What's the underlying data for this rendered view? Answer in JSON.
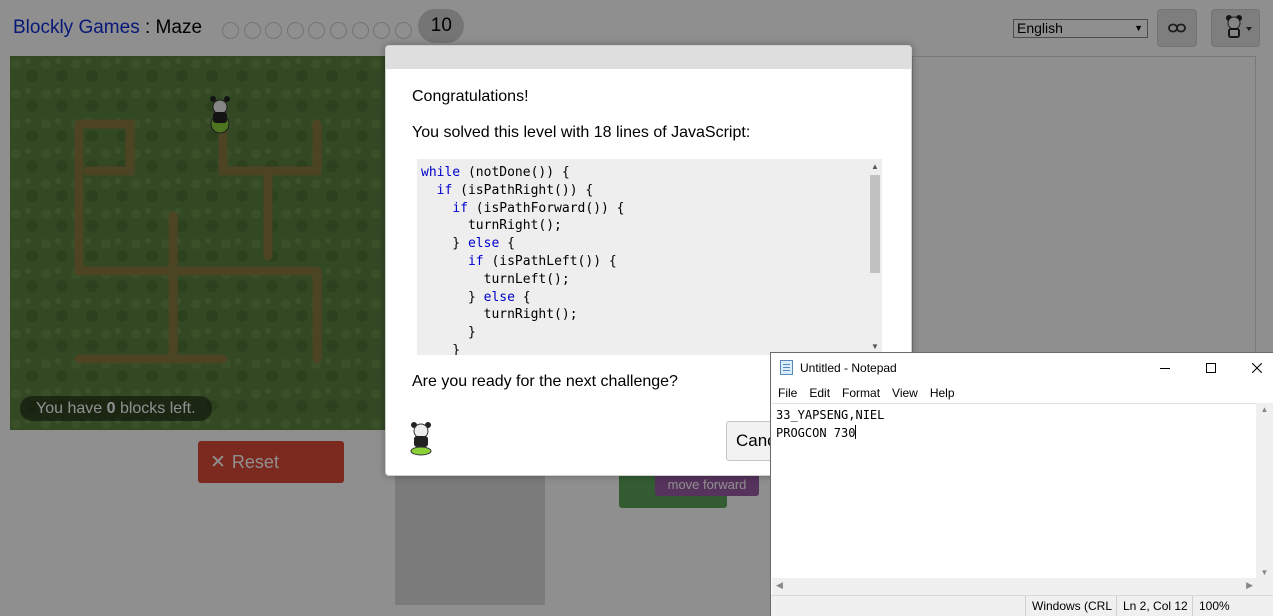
{
  "header": {
    "app_title": "Blockly Games",
    "separator": " : ",
    "game_title": "Maze",
    "current_level": "10",
    "language": "English"
  },
  "maze": {
    "blocks_left_prefix": "You have ",
    "blocks_left_count": "0",
    "blocks_left_suffix": " blocks left.",
    "reset_label": "Reset"
  },
  "workspace": {
    "block_label": "move forward"
  },
  "dialog": {
    "congrats": "Congratulations!",
    "solved": "You solved this level with 18 lines of JavaScript:",
    "code_lines": [
      "while (notDone()) {",
      "  if (isPathRight()) {",
      "    if (isPathForward()) {",
      "      turnRight();",
      "    } else {",
      "      if (isPathLeft()) {",
      "        turnLeft();",
      "      } else {",
      "        turnRight();",
      "      }",
      "    }"
    ],
    "question": "Are you ready for the next challenge?",
    "cancel_label": "Cancel"
  },
  "notepad": {
    "title": "Untitled - Notepad",
    "menu": [
      "File",
      "Edit",
      "Format",
      "View",
      "Help"
    ],
    "line1": "33_YAPSENG,NIEL",
    "line2": "PROGCON 730",
    "status_encoding": "Windows (CRLF)",
    "status_position": "Ln 2, Col 12",
    "status_zoom": "100%"
  },
  "colors": {
    "link_blue": "#0f2bd6",
    "reset_red": "#dd4b39",
    "block_purple": "#995ba5",
    "block_green": "#5ba55b",
    "maze_grass": "#5b8240",
    "maze_wall": "#8a7a40"
  }
}
